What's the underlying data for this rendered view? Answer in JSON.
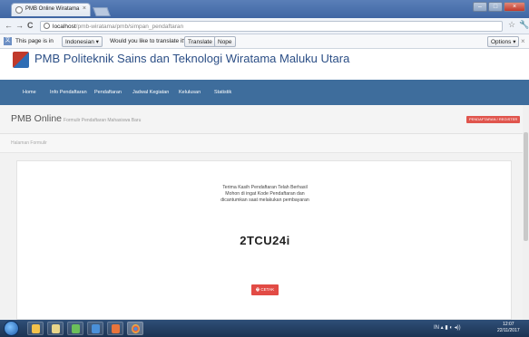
{
  "browser": {
    "tab_title": "PMB Online Wiratama",
    "tab_close": "×",
    "url_host": "localhost",
    "url_path": "/pmb-wiratama/pmb/simpan_pendaftaran",
    "icons": {
      "back": "back-arrow-icon",
      "forward": "forward-arrow-icon",
      "reload": "reload-icon",
      "star": "star-icon",
      "wrench": "wrench-icon"
    },
    "nav_glyphs": {
      "back": "←",
      "forward": "→",
      "reload": "C",
      "star": "☆",
      "wrench": "🔧"
    },
    "window_controls": {
      "minimize": "–",
      "maximize": "□",
      "close": "×"
    }
  },
  "translate_bar": {
    "text_prefix": "This page is in",
    "language": "Indonesian ▾",
    "question": "Would you like to translate it?",
    "translate_label": "Translate",
    "nope_label": "Nope",
    "options_label": "Options ▾",
    "close_glyph": "×"
  },
  "site": {
    "title": "PMB Politeknik Sains dan Teknologi Wiratama Maluku Utara",
    "nav": [
      "Home",
      "Info Pendaftaran",
      "Pendaftaran",
      "Jadwal Kegiatan",
      "Kelulusan",
      "Statistik"
    ]
  },
  "page_head": {
    "title": "PMB Online",
    "subtitle": "Formulir Pendaftaran Mahasiswa Baru",
    "register_badge": "PENDAFTARAN / REGISTER"
  },
  "breadcrumb": "Halaman Formulir",
  "result": {
    "line1": "Terima Kasih Pendaftaran Telah Berhasil",
    "line2": "Mohon di ingat Kode Pendaftaran dan",
    "line3": "dicantumkan saat melakukan pembayaran",
    "code": "2TCU24i",
    "print_label": "CETAK",
    "print_glyph": "🖶"
  },
  "taskbar": {
    "tray_text": "IN  ▴  ▮  ◐  ◂))",
    "time": "12:07",
    "date": "22/11/2017"
  }
}
